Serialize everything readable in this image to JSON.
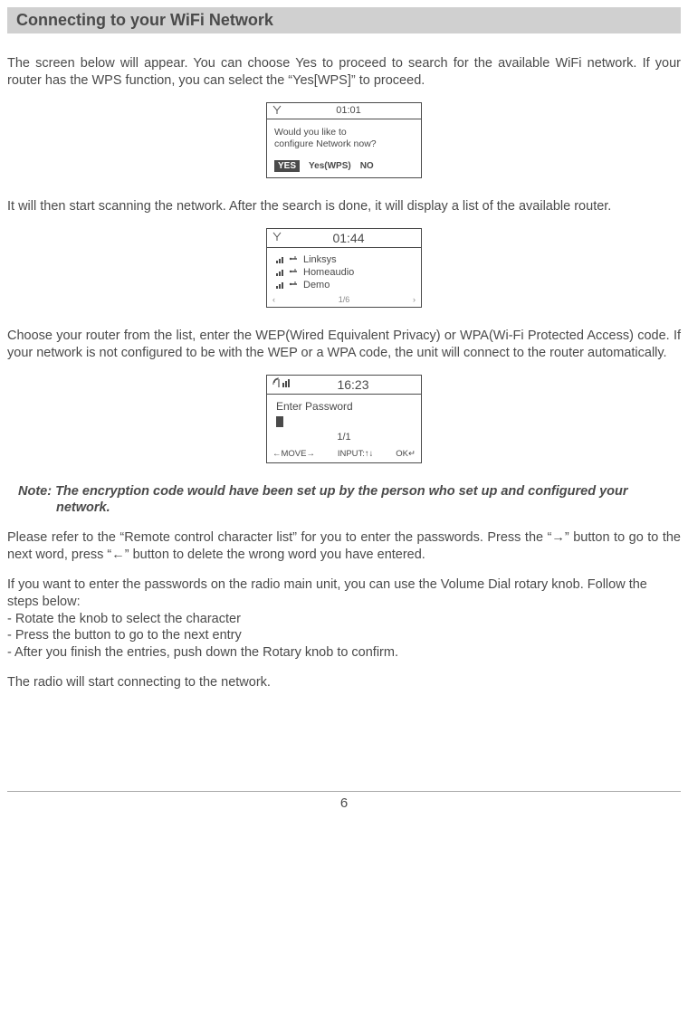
{
  "header": {
    "title": "Connecting to your WiFi Network"
  },
  "para1": "The screen below will appear. You can choose Yes to proceed to search for the available WiFi network.  If your router has the WPS function, you can select the “Yes[WPS]” to proceed.",
  "screen1": {
    "time": "01:01",
    "prompt": "Would you like to\nconfigure Network now?",
    "opt_yes": "YES",
    "opt_wps": "Yes(WPS)",
    "opt_no": "NO"
  },
  "para2": "It will then start scanning the network. After the search is done, it will display a list of the available router.",
  "screen2": {
    "time": "01:44",
    "routers": [
      "Linksys",
      "Homeaudio",
      "Demo"
    ],
    "pager": "1/6"
  },
  "para3": "Choose your router from the list, enter the WEP(Wired Equivalent Privacy) or WPA(Wi-Fi Protected Access) code. If your network is not configured to be with the WEP or a WPA code, the unit will connect to the router automatically.",
  "screen3": {
    "time": "16:23",
    "label": "Enter Password",
    "count": "1/1",
    "hint_move": "←MOVE→",
    "hint_input": "INPUT:↑↓",
    "hint_ok": "OK↵"
  },
  "note": "Note: The encryption code would have been set up by the person who set up and configured your network.",
  "para4": "Please refer to the “Remote control character list” for you to enter the passwords. Press the “→” button to go to the next word, press “←” button to delete the wrong word you have entered.",
  "para5": "If you want to enter the passwords on the radio main unit, you can use the Volume Dial rotary knob. Follow the steps below:",
  "bullets": [
    "-  Rotate the knob to select the character",
    "-  Press the  button to go to the next entry",
    "-  After you finish the entries, push down the Rotary knob to confirm."
  ],
  "para6": "The radio will start connecting to the network.",
  "page_number": "6"
}
